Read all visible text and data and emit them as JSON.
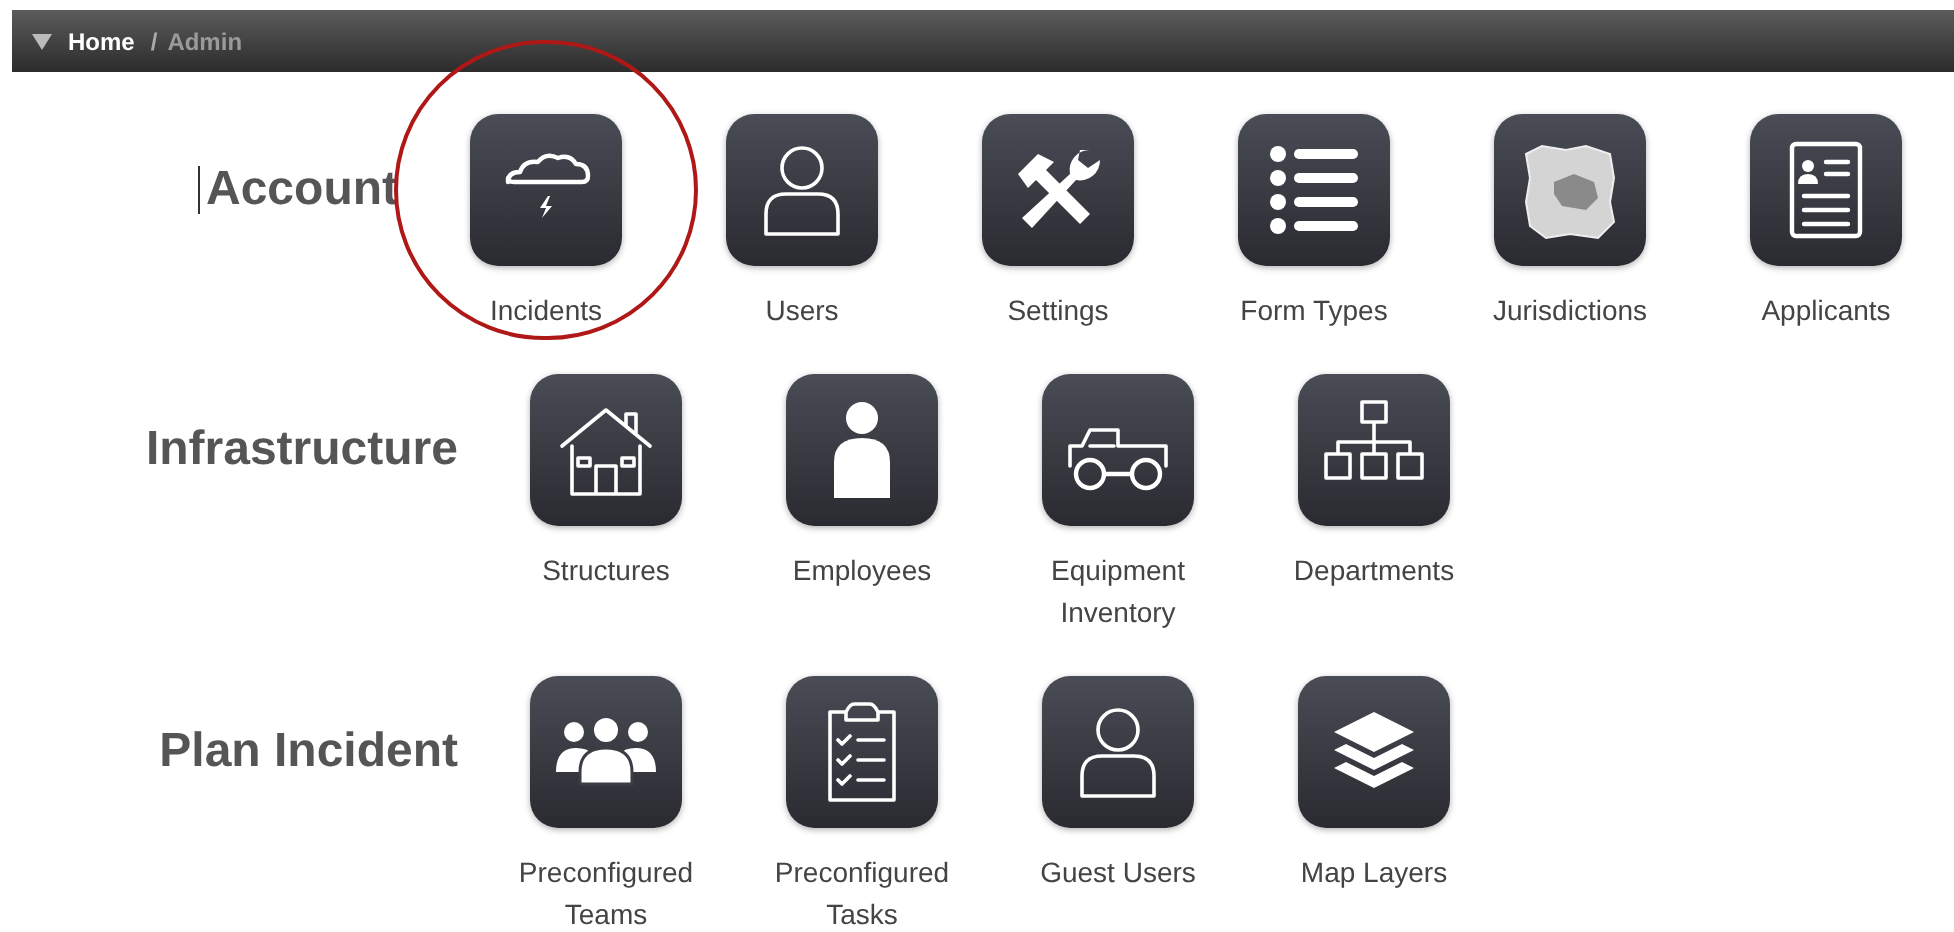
{
  "breadcrumb": {
    "items": [
      {
        "label": "Home",
        "selected": false
      },
      {
        "label": "Admin",
        "selected": true
      }
    ],
    "separator": "/"
  },
  "sections": [
    {
      "title": "Account",
      "cursor": true,
      "items": [
        {
          "label": "Incidents",
          "kind": "cloud",
          "circled": true
        },
        {
          "label": "Users",
          "kind": "user",
          "circled": false
        },
        {
          "label": "Settings",
          "kind": "tools",
          "circled": false
        },
        {
          "label": "Form Types",
          "kind": "list",
          "circled": false
        },
        {
          "label": "Jurisdictions",
          "kind": "map",
          "circled": false
        },
        {
          "label": "Applicants",
          "kind": "card",
          "circled": false
        }
      ]
    },
    {
      "title": "Infrastructure",
      "cursor": false,
      "items": [
        {
          "label": "Structures",
          "kind": "house",
          "circled": false
        },
        {
          "label": "Employees",
          "kind": "person",
          "circled": false
        },
        {
          "label": "Equipment Inventory",
          "kind": "truck",
          "circled": false
        },
        {
          "label": "Departments",
          "kind": "org",
          "circled": false
        }
      ]
    },
    {
      "title": "Plan Incident",
      "cursor": false,
      "items": [
        {
          "label": "Preconfigured Teams",
          "kind": "team",
          "circled": false
        },
        {
          "label": "Preconfigured Tasks",
          "kind": "clipboard",
          "circled": false
        },
        {
          "label": "Guest Users",
          "kind": "user",
          "circled": false
        },
        {
          "label": "Map Layers",
          "kind": "layers",
          "circled": false
        }
      ]
    }
  ]
}
